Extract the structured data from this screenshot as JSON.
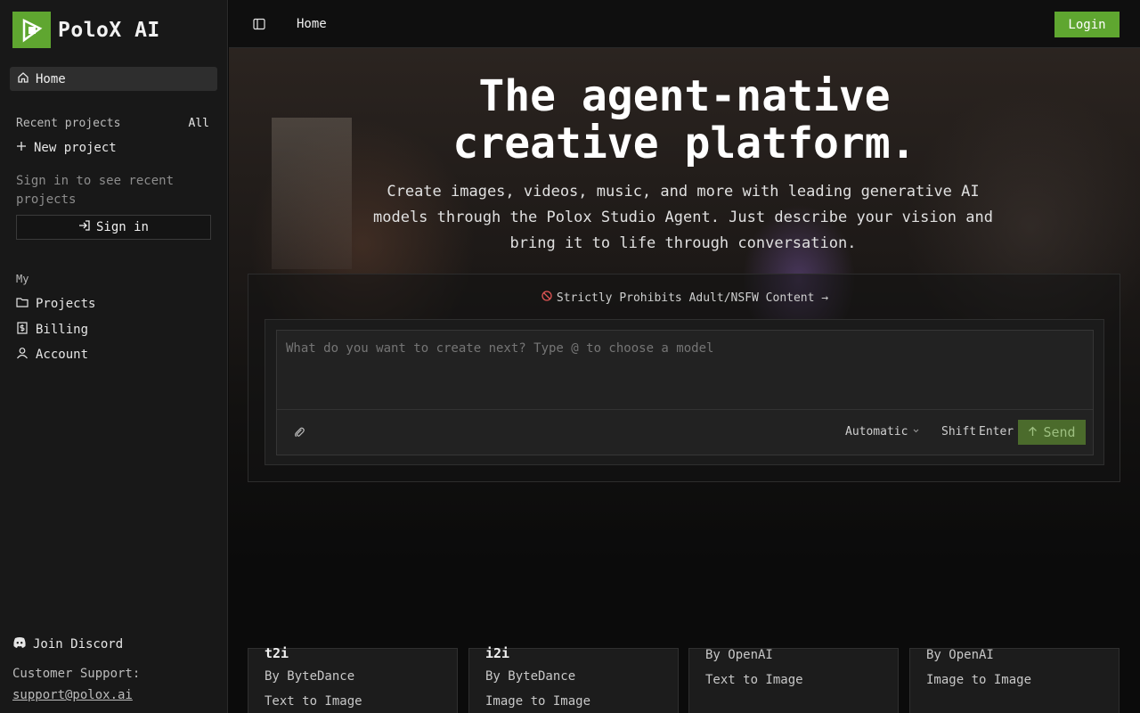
{
  "brand": {
    "name": "PoloX AI",
    "accent": "#5fa630"
  },
  "sidebar": {
    "home_label": "Home",
    "recent_projects_label": "Recent projects",
    "all_label": "All",
    "new_project_label": "New project",
    "signin_hint": "Sign in to see recent projects",
    "signin_label": "Sign in",
    "my_label": "My",
    "items": [
      {
        "label": "Projects",
        "icon": "folder-icon"
      },
      {
        "label": "Billing",
        "icon": "billing-icon"
      },
      {
        "label": "Account",
        "icon": "user-icon"
      }
    ],
    "discord_label": "Join Discord",
    "support_label": "Customer Support:",
    "support_email": "support@polox.ai"
  },
  "topbar": {
    "breadcrumb": "Home",
    "login_label": "Login"
  },
  "hero": {
    "headline_line1": "The agent-native",
    "headline_line2": "creative platform.",
    "subhead": "Create images, videos, music, and more with leading generative AI models through the Polox Studio Agent. Just describe your vision and bring it to life through conversation."
  },
  "composer": {
    "notice": "Strictly Prohibits Adult/NSFW Content →",
    "placeholder": "What do you want to create next? Type @ to choose a model",
    "mode_label": "Automatic",
    "shift_label": "Shift",
    "enter_label": "Enter",
    "send_label": "Send"
  },
  "cards": [
    {
      "title": "t2i",
      "by": "By ByteDance",
      "type": "Text to Image"
    },
    {
      "title": "i2i",
      "by": "By ByteDance",
      "type": "Image to Image"
    },
    {
      "title": "",
      "by": "By OpenAI",
      "type": "Text to Image"
    },
    {
      "title": "",
      "by": "By OpenAI",
      "type": "Image to Image"
    }
  ]
}
